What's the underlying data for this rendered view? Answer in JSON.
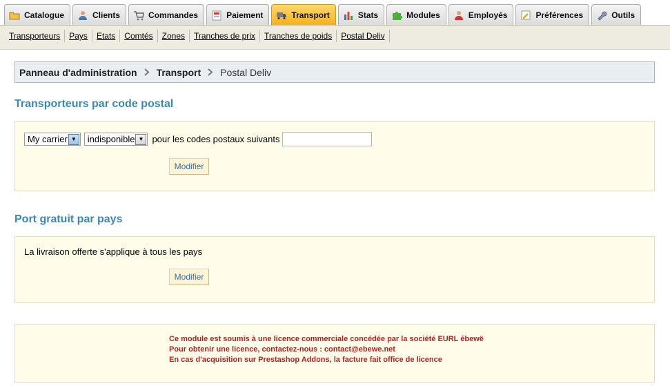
{
  "tabs": [
    {
      "label": "Catalogue",
      "icon": "folder-icon"
    },
    {
      "label": "Clients",
      "icon": "user-icon"
    },
    {
      "label": "Commandes",
      "icon": "cart-icon"
    },
    {
      "label": "Paiement",
      "icon": "payment-icon"
    },
    {
      "label": "Transport",
      "icon": "truck-icon",
      "active": true
    },
    {
      "label": "Stats",
      "icon": "bar-chart-icon"
    },
    {
      "label": "Modules",
      "icon": "puzzle-icon"
    },
    {
      "label": "Employés",
      "icon": "employee-icon"
    },
    {
      "label": "Préférences",
      "icon": "preferences-icon"
    },
    {
      "label": "Outils",
      "icon": "wrench-icon"
    }
  ],
  "subnav": [
    "Transporteurs",
    "Pays",
    "Etats",
    "Comtés",
    "Zones",
    "Tranches de prix",
    "Tranches de poids",
    "Postal Deliv"
  ],
  "breadcrumb": {
    "root": "Panneau d'administration",
    "section": "Transport",
    "current": "Postal Deliv"
  },
  "postal": {
    "title": "Transporteurs par code postal",
    "carrier_select": "My carrier",
    "status_select": "indisponible",
    "suffix_text": "pour les codes postaux suivants",
    "postal_codes_value": "",
    "submit_label": "Modifier"
  },
  "free_shipping": {
    "title": "Port gratuit par pays",
    "text": "La livraison offerte s'applique à tous les pays",
    "submit_label": "Modifier"
  },
  "license": {
    "line1": "Ce module est soumis à une licence commerciale concédée par la société EURL ébewë",
    "line2": "Pour obtenir une licence, contactez-nous : contact@ebewe.net",
    "line3": "En cas d'acquisition sur Prestashop Addons, la facture fait office de licence"
  }
}
